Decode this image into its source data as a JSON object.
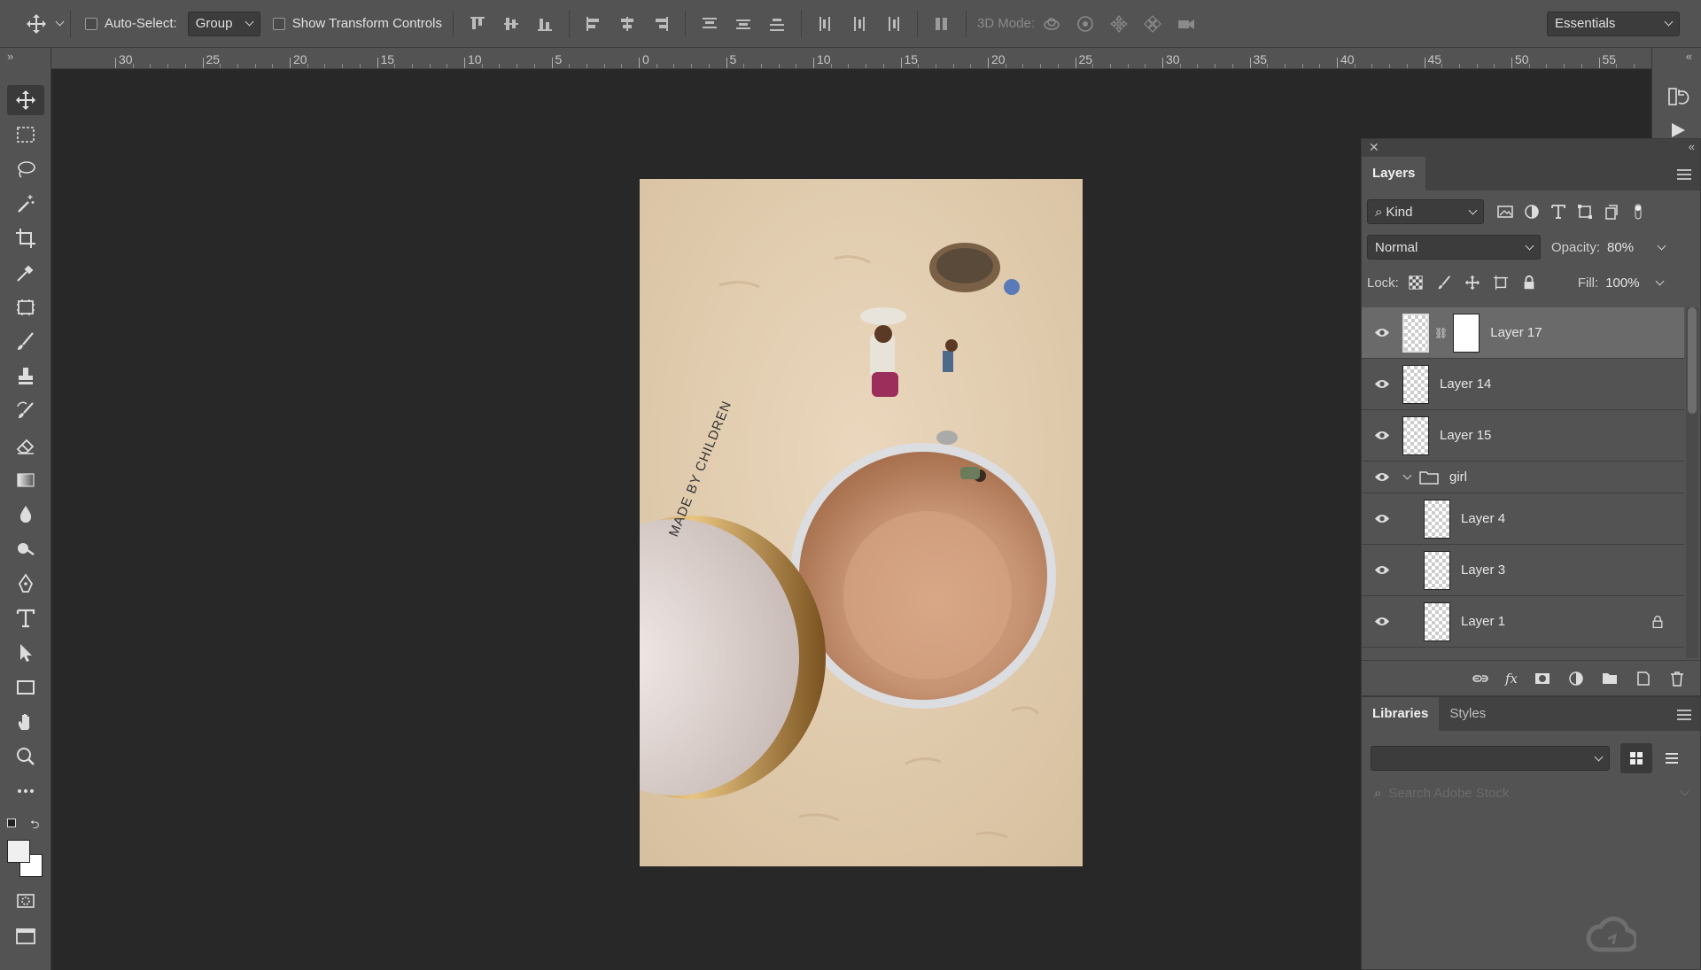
{
  "options_bar": {
    "auto_select_label": "Auto-Select:",
    "auto_select_value": "Group",
    "show_transform_label": "Show Transform Controls",
    "mode_3d_label": "3D Mode:",
    "workspace": "Essentials"
  },
  "ruler": {
    "labels": [
      "30",
      "25",
      "20",
      "15",
      "10",
      "5",
      "0",
      "5",
      "10",
      "15",
      "20",
      "25",
      "30",
      "35",
      "40",
      "45",
      "50",
      "55"
    ]
  },
  "document": {
    "package_text": "MADE BY CHILDREN"
  },
  "layers_panel": {
    "tab": "Layers",
    "filter_kind": "Kind",
    "blend_mode": "Normal",
    "opacity_label": "Opacity:",
    "opacity_value": "80%",
    "lock_label": "Lock:",
    "fill_label": "Fill:",
    "fill_value": "100%",
    "layers": [
      {
        "name": "Layer 17",
        "selected": true
      },
      {
        "name": "Layer 14"
      },
      {
        "name": "Layer 15"
      },
      {
        "name": "girl",
        "group": true
      },
      {
        "name": "Layer 4"
      },
      {
        "name": "Layer 3"
      },
      {
        "name": "Layer 1",
        "locked": true
      }
    ]
  },
  "libraries_panel": {
    "tabs": [
      "Libraries",
      "Styles"
    ],
    "search_placeholder": "Search Adobe Stock"
  },
  "colors": {
    "panel": "#535353",
    "canvas": "#282828",
    "selected_layer": "#6a6a6a",
    "sand": "#e3cfb3",
    "powder": "#b88363"
  }
}
